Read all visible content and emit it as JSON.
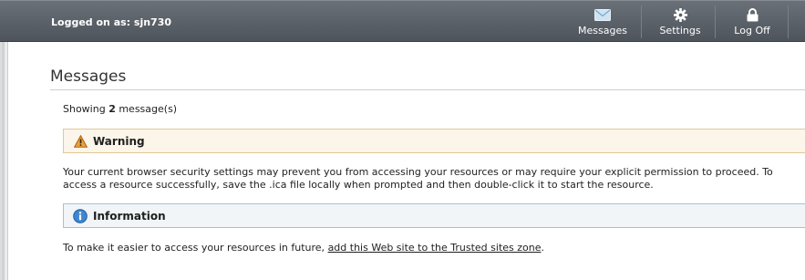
{
  "header": {
    "logged_on": "Logged on as: sjn730",
    "nav": {
      "messages": "Messages",
      "settings": "Settings",
      "logoff": "Log Off"
    }
  },
  "main": {
    "title": "Messages",
    "showing_prefix": "Showing ",
    "showing_count": "2",
    "showing_suffix": " message(s)",
    "warning": {
      "title": "Warning",
      "text": "Your current browser security settings may prevent you from accessing your resources or may require your explicit permission to proceed. To access a resource successfully, save the .ica file locally when prompted and then double-click it to start the resource."
    },
    "information": {
      "title": "Information",
      "text_prefix": "To make it easier to access your resources in future, ",
      "link": "add this Web site to the Trusted sites zone",
      "text_suffix": "."
    }
  },
  "colors": {
    "topbar": "#5a6067",
    "warning_bg": "#fbf5ea",
    "warning_border": "#e2c896",
    "info_bg": "#f1f5f8",
    "info_border": "#a8c0d4"
  },
  "icons": {
    "messages": "envelope-icon",
    "settings": "gear-icon",
    "logoff": "lock-icon",
    "warning": "warning-triangle-icon",
    "information": "info-circle-icon"
  }
}
